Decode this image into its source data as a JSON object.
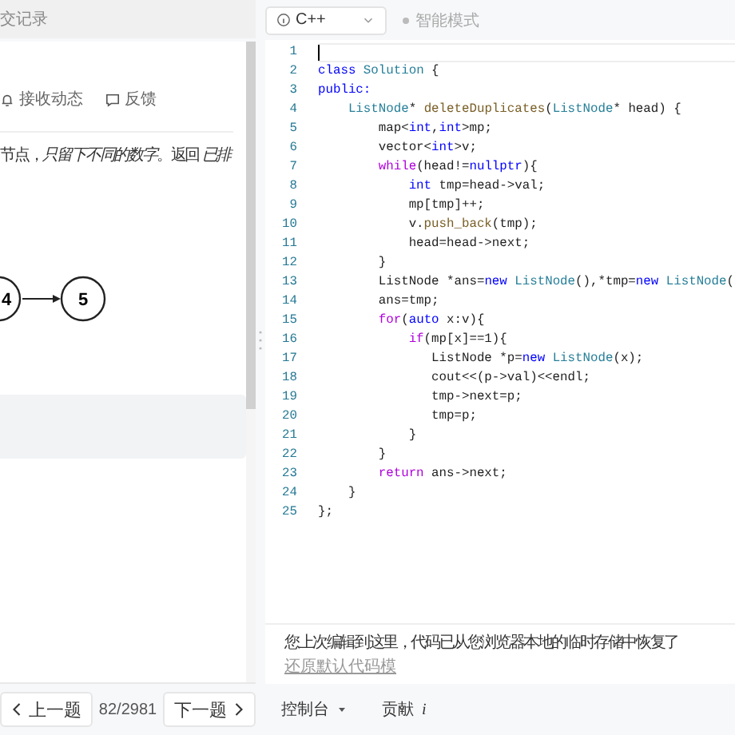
{
  "left_panel": {
    "tab": "交记录",
    "actions": [
      {
        "kind": "bell",
        "label": "接收动态"
      },
      {
        "kind": "comment",
        "label": "反馈"
      }
    ],
    "description": "节点，*只留下不同的数字*。返回 *已排*",
    "diagram_nodes": [
      "4",
      "5"
    ]
  },
  "editor": {
    "language": "C++",
    "smart_mode": {
      "label": "智能模式",
      "on": false
    },
    "lines": [
      {
        "number": "1"
      },
      {
        "number": "2",
        "tokens": [
          {
            "kind": "kw",
            "text": "class "
          },
          {
            "kind": "type",
            "text": "Solution"
          },
          {
            "kind": "plain",
            "text": " {"
          }
        ]
      },
      {
        "number": "3",
        "tokens": [
          {
            "kind": "kw",
            "text": "public:"
          }
        ]
      },
      {
        "number": "4",
        "tokens": [
          {
            "kind": "type",
            "text": "    ListNode"
          },
          {
            "kind": "plain",
            "text": "* "
          },
          {
            "kind": "fn",
            "text": "deleteDuplicates"
          },
          {
            "kind": "plain",
            "text": "("
          },
          {
            "kind": "type",
            "text": "ListNode"
          },
          {
            "kind": "plain",
            "text": "* head) {"
          }
        ]
      },
      {
        "number": "5",
        "tokens": [
          {
            "kind": "plain",
            "text": "        map<"
          },
          {
            "kind": "kw",
            "text": "int"
          },
          {
            "kind": "plain",
            "text": ","
          },
          {
            "kind": "kw",
            "text": "int"
          },
          {
            "kind": "plain",
            "text": ">mp;"
          }
        ]
      },
      {
        "number": "6",
        "tokens": [
          {
            "kind": "plain",
            "text": "        vector<"
          },
          {
            "kind": "kw",
            "text": "int"
          },
          {
            "kind": "plain",
            "text": ">v;"
          }
        ]
      },
      {
        "number": "7",
        "tokens": [
          {
            "kind": "ctrl",
            "text": "        while"
          },
          {
            "kind": "plain",
            "text": "(head!="
          },
          {
            "kind": "kw",
            "text": "nullptr"
          },
          {
            "kind": "plain",
            "text": "){"
          }
        ]
      },
      {
        "number": "8",
        "tokens": [
          {
            "kind": "kw",
            "text": "            int"
          },
          {
            "kind": "plain",
            "text": " tmp=head->val;"
          }
        ]
      },
      {
        "number": "9",
        "tokens": [
          {
            "kind": "plain",
            "text": "            mp[tmp]++;"
          }
        ]
      },
      {
        "number": "10",
        "tokens": [
          {
            "kind": "plain",
            "text": "            v."
          },
          {
            "kind": "fn",
            "text": "push_back"
          },
          {
            "kind": "plain",
            "text": "(tmp);"
          }
        ]
      },
      {
        "number": "11",
        "tokens": [
          {
            "kind": "plain",
            "text": "            head=head->next;"
          }
        ]
      },
      {
        "number": "12",
        "tokens": [
          {
            "kind": "plain",
            "text": "        }"
          }
        ]
      },
      {
        "number": "13",
        "tokens": [
          {
            "kind": "plain",
            "text": "        ListNode *ans="
          },
          {
            "kind": "kw",
            "text": "new "
          },
          {
            "kind": "type",
            "text": "ListNode"
          },
          {
            "kind": "plain",
            "text": "(),*tmp="
          },
          {
            "kind": "kw",
            "text": "new "
          },
          {
            "kind": "type",
            "text": "ListNode"
          },
          {
            "kind": "plain",
            "text": "("
          }
        ]
      },
      {
        "number": "14",
        "tokens": [
          {
            "kind": "plain",
            "text": "        ans=tmp;"
          }
        ]
      },
      {
        "number": "15",
        "tokens": [
          {
            "kind": "ctrl",
            "text": "        for"
          },
          {
            "kind": "plain",
            "text": "("
          },
          {
            "kind": "kw",
            "text": "auto"
          },
          {
            "kind": "plain",
            "text": " x:v){"
          }
        ]
      },
      {
        "number": "16",
        "tokens": [
          {
            "kind": "ctrl",
            "text": "            if"
          },
          {
            "kind": "plain",
            "text": "(mp[x]==1){"
          }
        ]
      },
      {
        "number": "17",
        "tokens": [
          {
            "kind": "plain",
            "text": "               ListNode *p="
          },
          {
            "kind": "kw",
            "text": "new "
          },
          {
            "kind": "type",
            "text": "ListNode"
          },
          {
            "kind": "plain",
            "text": "(x);"
          }
        ]
      },
      {
        "number": "18",
        "tokens": [
          {
            "kind": "plain",
            "text": "               cout<<(p->val)<<endl;"
          }
        ]
      },
      {
        "number": "19",
        "tokens": [
          {
            "kind": "plain",
            "text": "               tmp->next=p;"
          }
        ]
      },
      {
        "number": "20",
        "tokens": [
          {
            "kind": "plain",
            "text": "               tmp=p;"
          }
        ]
      },
      {
        "number": "21",
        "tokens": [
          {
            "kind": "plain",
            "text": "            }"
          }
        ]
      },
      {
        "number": "22",
        "tokens": [
          {
            "kind": "plain",
            "text": "        }"
          }
        ]
      },
      {
        "number": "23",
        "tokens": [
          {
            "kind": "ctrl",
            "text": "        return"
          },
          {
            "kind": "plain",
            "text": " ans->next;"
          }
        ]
      },
      {
        "number": "24",
        "tokens": [
          {
            "kind": "plain",
            "text": "    }"
          }
        ]
      },
      {
        "number": "25",
        "tokens": [
          {
            "kind": "plain",
            "text": "};"
          }
        ]
      }
    ]
  },
  "notice": {
    "text": "您上次编辑到这里，代码已从您浏览器本地的临时存储中恢复了",
    "link": "还原默认代码模"
  },
  "footer": {
    "prev": "上一题",
    "counter": "82/2981",
    "next": "下一题",
    "console": "控制台",
    "contribute": "贡献",
    "contribute_icon": "i"
  }
}
